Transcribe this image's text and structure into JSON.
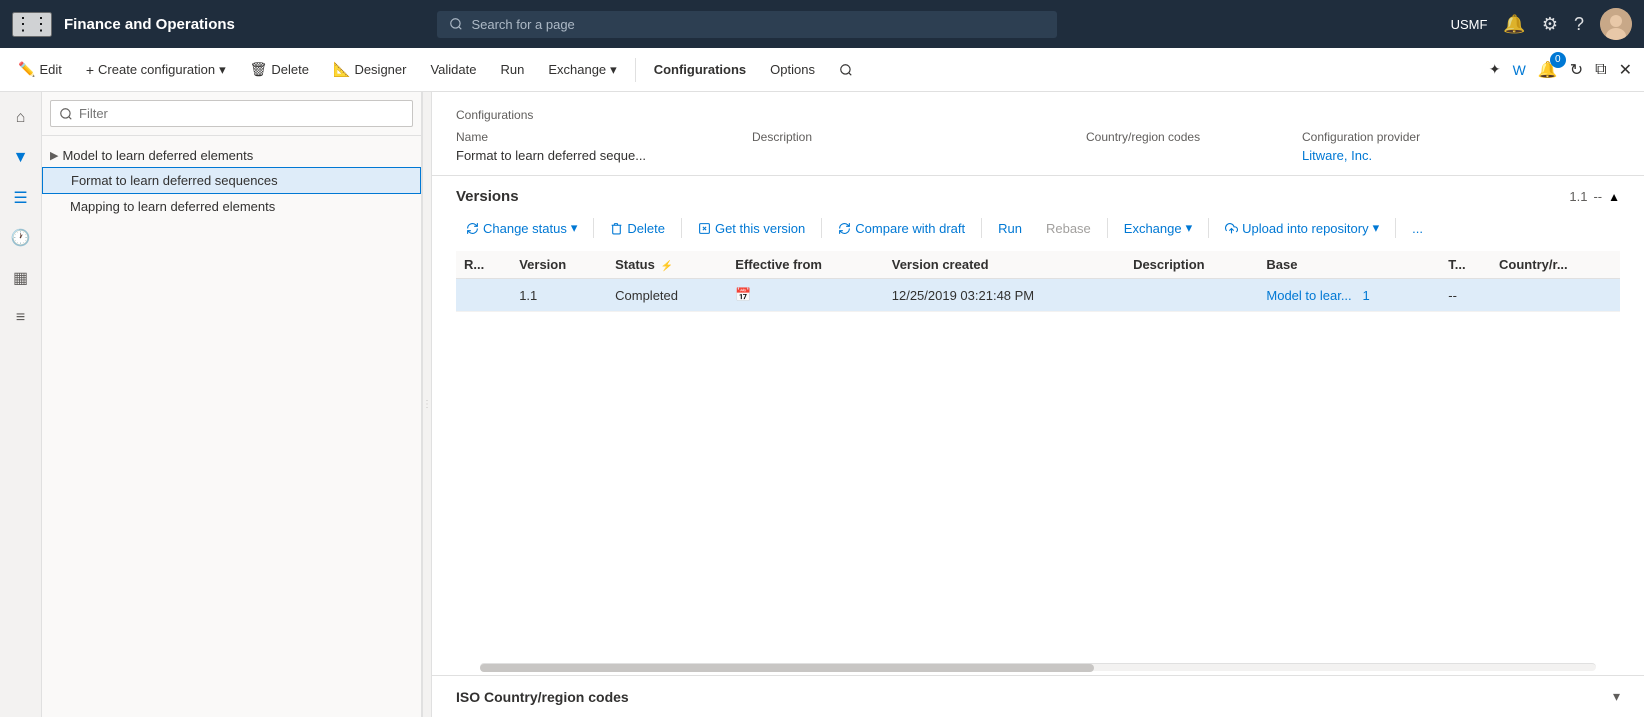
{
  "topNav": {
    "gridIconLabel": "⊞",
    "appTitle": "Finance and Operations",
    "search": {
      "placeholder": "Search for a page"
    },
    "userLabel": "USMF",
    "notificationIcon": "🔔",
    "settingsIcon": "⚙",
    "helpIcon": "?",
    "avatarLabel": "U"
  },
  "commandBar": {
    "editLabel": "Edit",
    "createConfigLabel": "Create configuration",
    "deleteLabel": "Delete",
    "designerLabel": "Designer",
    "validateLabel": "Validate",
    "runLabel": "Run",
    "exchangeLabel": "Exchange",
    "configurationsLabel": "Configurations",
    "optionsLabel": "Options",
    "searchIconLabel": "🔍"
  },
  "sidebar": {
    "icons": [
      {
        "name": "home-icon",
        "glyph": "⌂"
      },
      {
        "name": "filter-icon",
        "glyph": "⚡"
      },
      {
        "name": "list-icon",
        "glyph": "☰"
      },
      {
        "name": "calendar-sidebar-icon",
        "glyph": "📅"
      },
      {
        "name": "grid-sidebar-icon",
        "glyph": "▦"
      }
    ]
  },
  "treePanel": {
    "filterPlaceholder": "Filter",
    "parentNode": "Model to learn deferred elements",
    "children": [
      {
        "label": "Format to learn deferred sequences",
        "selected": true
      },
      {
        "label": "Mapping to learn deferred elements",
        "selected": false
      }
    ]
  },
  "configurations": {
    "sectionLabel": "Configurations",
    "columns": [
      {
        "header": "Name",
        "value": "Format to learn deferred seque..."
      },
      {
        "header": "Description",
        "value": ""
      },
      {
        "header": "Country/region codes",
        "value": ""
      },
      {
        "header": "Configuration provider",
        "value": "Litware, Inc.",
        "isLink": true
      }
    ]
  },
  "versions": {
    "sectionTitle": "Versions",
    "versionMeta": "1.1",
    "metaSeparator": "--",
    "toolbar": {
      "changeStatus": "Change status",
      "delete": "Delete",
      "getThisVersion": "Get this version",
      "compareWithDraft": "Compare with draft",
      "run": "Run",
      "rebase": "Rebase",
      "exchange": "Exchange",
      "uploadIntoRepository": "Upload into repository",
      "moreOptions": "..."
    },
    "table": {
      "columns": [
        {
          "key": "r",
          "label": "R..."
        },
        {
          "key": "version",
          "label": "Version"
        },
        {
          "key": "status",
          "label": "Status"
        },
        {
          "key": "effectiveFrom",
          "label": "Effective from"
        },
        {
          "key": "versionCreated",
          "label": "Version created"
        },
        {
          "key": "description",
          "label": "Description"
        },
        {
          "key": "base",
          "label": "Base"
        },
        {
          "key": "t",
          "label": "T..."
        },
        {
          "key": "countryRegion",
          "label": "Country/r..."
        }
      ],
      "rows": [
        {
          "r": "",
          "version": "1.1",
          "status": "Completed",
          "effectiveFrom": "",
          "versionCreated": "12/25/2019 03:21:48 PM",
          "description": "",
          "base": "Model to lear...",
          "baseLink": "1",
          "t": "--",
          "countryRegion": "",
          "selected": true
        }
      ]
    }
  },
  "isoSection": {
    "title": "ISO Country/region codes"
  }
}
